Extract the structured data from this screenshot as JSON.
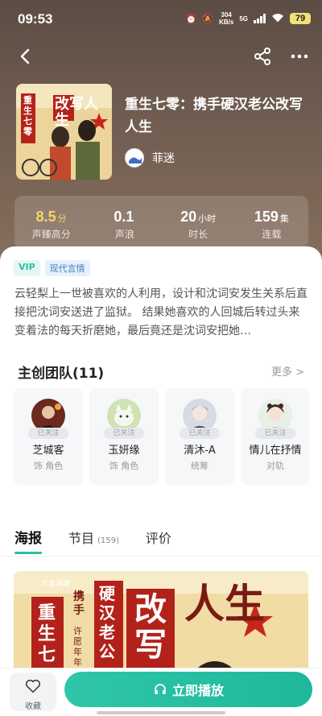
{
  "status": {
    "time": "09:53",
    "net_speed_top": "304",
    "net_speed_bottom": "KB/s",
    "network": "5G",
    "battery": "79"
  },
  "book": {
    "title": "重生七零：携手硬汉老公改写人生",
    "author": "菲迷",
    "cover_title": "重生七零",
    "cover_headline": "改写人生"
  },
  "stats": [
    {
      "value": "8.5",
      "unit": "分",
      "label": "声臻高分"
    },
    {
      "value": "0.1",
      "unit": "",
      "label": "声浪"
    },
    {
      "value": "20",
      "unit": "小时",
      "label": "时长"
    },
    {
      "value": "159",
      "unit": "集",
      "label": "连载"
    }
  ],
  "tags": {
    "vip": "VIP",
    "genre": "现代言情"
  },
  "description": "云轻梨上一世被喜欢的人利用，设计和沈词安发生关系后直接把沈词安送进了监狱。 结果她喜欢的人回城后转过头来变着法的每天折磨她，最后竟还是沈词安把她…",
  "team": {
    "title": "主创团队(11)",
    "more": "更多 >",
    "followed_label": "已关注",
    "members": [
      {
        "name": "芝城客",
        "role": "饰 角色"
      },
      {
        "name": "玉妍缘",
        "role": "饰 角色"
      },
      {
        "name": "清沐-A",
        "role": "统筹"
      },
      {
        "name": "情儿在抒情",
        "role": "对轨"
      }
    ]
  },
  "tabs": [
    {
      "label": "海报",
      "count": ""
    },
    {
      "label": "节目",
      "count": "(159)"
    },
    {
      "label": "评价",
      "count": ""
    }
  ],
  "poster": {
    "brand": "大鱼海塘",
    "line1": "重生七",
    "line2": "携手",
    "line3": "硬汉老公",
    "line4": "改写",
    "line5": "人生",
    "sub": "许愿年年"
  },
  "bottom": {
    "favorite_label": "收藏",
    "play_label": "立即播放"
  },
  "colors": {
    "accent": "#2bbf9f",
    "gold": "#f5d36b"
  }
}
